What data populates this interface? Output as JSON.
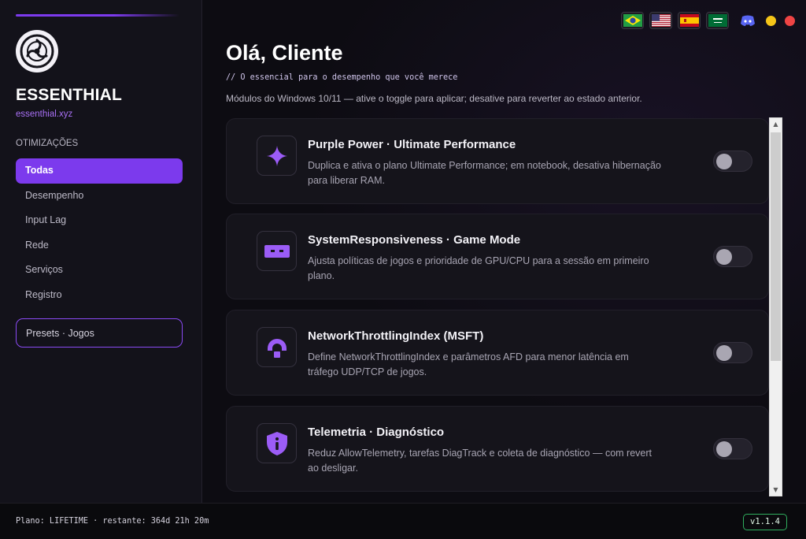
{
  "brand": {
    "title": "ESSENTHIAL",
    "url": "essenthial.xyz"
  },
  "sidebar": {
    "section_label": "OTIMIZAÇÕES",
    "items": [
      {
        "label": "Todas",
        "active": true
      },
      {
        "label": "Desempenho",
        "active": false
      },
      {
        "label": "Input Lag",
        "active": false
      },
      {
        "label": "Rede",
        "active": false
      },
      {
        "label": "Serviços",
        "active": false
      },
      {
        "label": "Registro",
        "active": false
      }
    ],
    "presets_label": "Presets · Jogos"
  },
  "topbar": {
    "flags": [
      "brazil-flag",
      "usa-flag",
      "spain-flag",
      "saudi-arabia-flag"
    ],
    "icons": [
      "discord-icon",
      "minimize-dot",
      "close-dot"
    ]
  },
  "header": {
    "greeting": "Olá, Cliente",
    "tagline": "// O essencial para o desempenho que você merece",
    "subtitle": "Módulos do Windows 10/11 — ative o toggle para aplicar; desative para reverter ao estado anterior."
  },
  "modules": [
    {
      "icon": "sparkle-icon",
      "title": "Purple Power · Ultimate Performance",
      "description": "Duplica e ativa o plano Ultimate Performance; em notebook, desativa hibernação para liberar RAM.",
      "enabled": false
    },
    {
      "icon": "gamepad-icon",
      "title": "SystemResponsiveness · Game Mode",
      "description": "Ajusta políticas de jogos e prioridade de GPU/CPU para a sessão em primeiro plano.",
      "enabled": false
    },
    {
      "icon": "network-arch-icon",
      "title": "NetworkThrottlingIndex (MSFT)",
      "description": "Define NetworkThrottlingIndex e parâmetros AFD para menor latência em tráfego UDP/TCP de jogos.",
      "enabled": false
    },
    {
      "icon": "shield-info-icon",
      "title": "Telemetria · Diagnóstico",
      "description": "Reduz AllowTelemetry, tarefas DiagTrack e coleta de diagnóstico — com revert ao desligar.",
      "enabled": false
    }
  ],
  "footer": {
    "plan": "Plano: LIFETIME · restante: 364d 21h 20m",
    "version": "v1.1.4"
  },
  "colors": {
    "accent": "#7c3aed",
    "accent_light": "#a970f5",
    "status_green": "#2fae5e",
    "dot_yellow": "#f5c518",
    "dot_red": "#ef4444"
  }
}
